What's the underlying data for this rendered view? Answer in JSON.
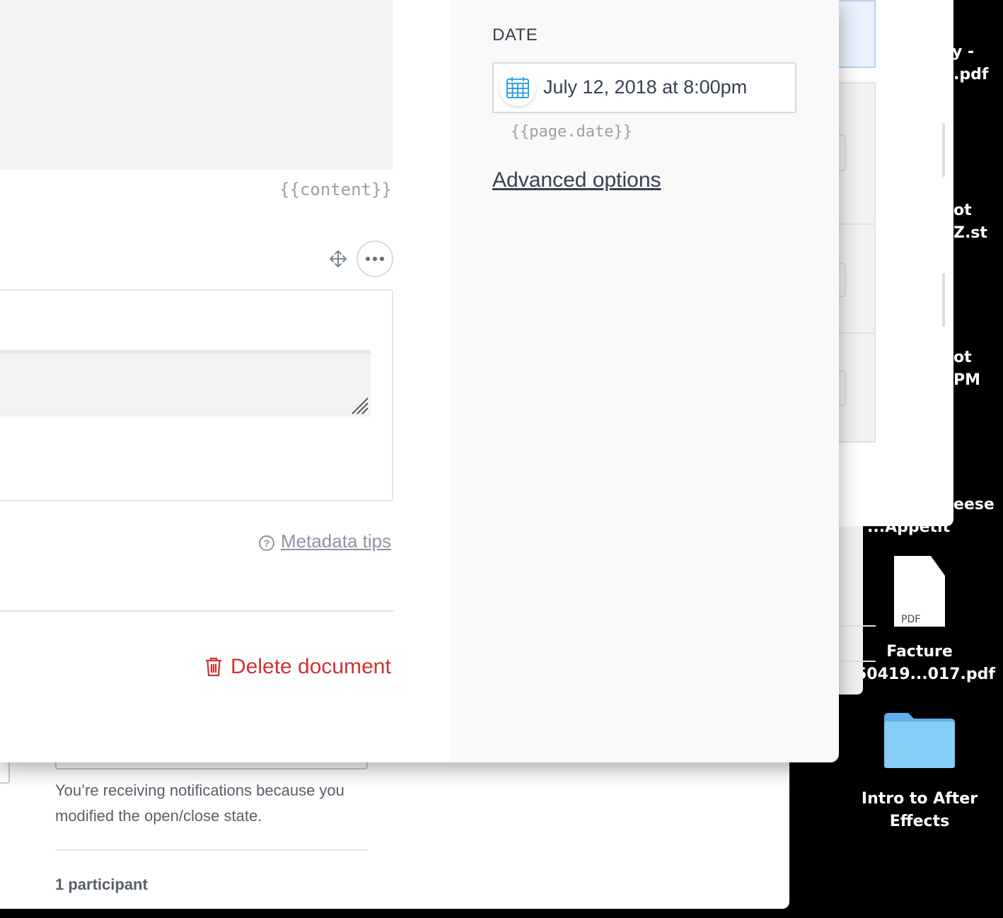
{
  "modal": {
    "content_hint": "{{content}}",
    "metadata_tips_label": "Metadata tips",
    "delete_label": "Delete document",
    "date_section": {
      "label": "DATE",
      "value": "July 12, 2018 at 8:00pm",
      "hint": "{{page.date}}"
    },
    "advanced_options_label": "Advanced options"
  },
  "back_window": {
    "notification_text": "You’re receiving notifications because you modified the open/close state.",
    "participants_text": "1 participant"
  },
  "desktop": {
    "partial_labels": [
      {
        "text": "y -"
      },
      {
        "text": ".pdf"
      },
      {
        "text": "ot"
      },
      {
        "text": "Z.st"
      },
      {
        "text": "ot"
      },
      {
        "text": "PM"
      },
      {
        "text": "eese"
      },
      {
        "text": "...Appetit"
      }
    ],
    "icons": [
      {
        "line1": "Facture",
        "line2": "50419...017.pdf",
        "type_label": "PDF"
      },
      {
        "line1": "Intro to After",
        "line2": "Effects"
      }
    ]
  },
  "colors": {
    "danger": "#cc3333",
    "calendar_accent": "#1a9ae0",
    "folder": "#7cc6f5"
  }
}
